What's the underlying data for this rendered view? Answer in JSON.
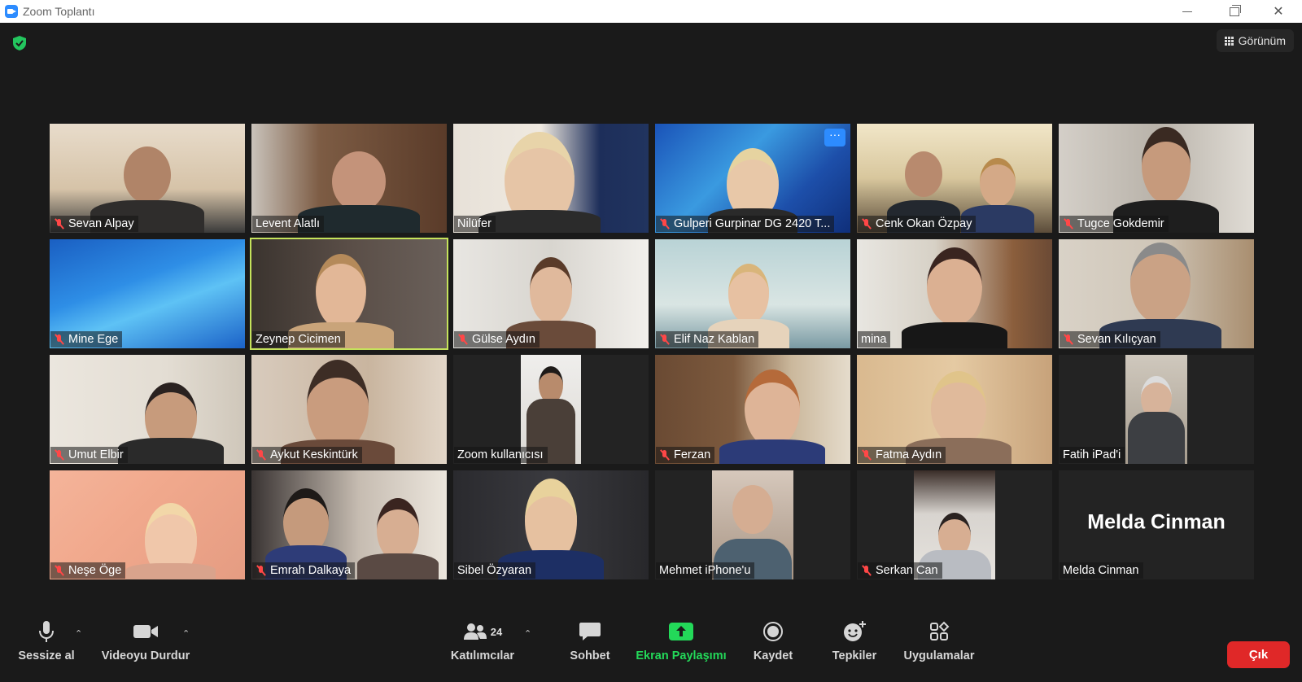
{
  "window": {
    "title": "Zoom Toplantı"
  },
  "header": {
    "view_label": "Görünüm"
  },
  "participants": [
    {
      "name": "Sevan Alpay",
      "muted": true
    },
    {
      "name": "Levent Alatlı",
      "muted": false
    },
    {
      "name": "Nilüfer",
      "muted": false
    },
    {
      "name": "Gulperi Gurpinar DG 2420 T...",
      "muted": true
    },
    {
      "name": "Cenk Okan Özpay",
      "muted": true
    },
    {
      "name": "Tugce Gokdemir",
      "muted": true
    },
    {
      "name": "Mine Ege",
      "muted": true
    },
    {
      "name": "Zeynep Cicimen",
      "muted": false,
      "active_speaker": true
    },
    {
      "name": "Gülse Aydın",
      "muted": true
    },
    {
      "name": "Elif Naz Kablan",
      "muted": true
    },
    {
      "name": "mina",
      "muted": false
    },
    {
      "name": "Sevan Kılıçyan",
      "muted": true
    },
    {
      "name": "Umut Elbir",
      "muted": true
    },
    {
      "name": "Aykut Keskintürk",
      "muted": true
    },
    {
      "name": "Zoom kullanıcısı",
      "muted": false
    },
    {
      "name": "Ferzan",
      "muted": true
    },
    {
      "name": "Fatma Aydın",
      "muted": true
    },
    {
      "name": "Fatih iPad'i",
      "muted": false
    },
    {
      "name": "Neşe Öge",
      "muted": true
    },
    {
      "name": "Emrah Dalkaya",
      "muted": true
    },
    {
      "name": "Sibel Özyaran",
      "muted": false
    },
    {
      "name": "Mehmet iPhone'u",
      "muted": false
    },
    {
      "name": "Serkan Can",
      "muted": true
    },
    {
      "name": "Melda Cinman",
      "muted": false,
      "video_off_name": "Melda Cinman"
    }
  ],
  "toolbar": {
    "mute_label": "Sessize al",
    "video_label": "Videoyu Durdur",
    "participants_label": "Katılımcılar",
    "participants_count": "24",
    "chat_label": "Sohbet",
    "share_label": "Ekran Paylaşımı",
    "record_label": "Kaydet",
    "reactions_label": "Tepkiler",
    "apps_label": "Uygulamalar",
    "leave_label": "Çık"
  },
  "colors": {
    "active_speaker_border": "#c5e35b",
    "share_green": "#23d959",
    "leave_red": "#e02828",
    "muted_red": "#ff4747"
  }
}
